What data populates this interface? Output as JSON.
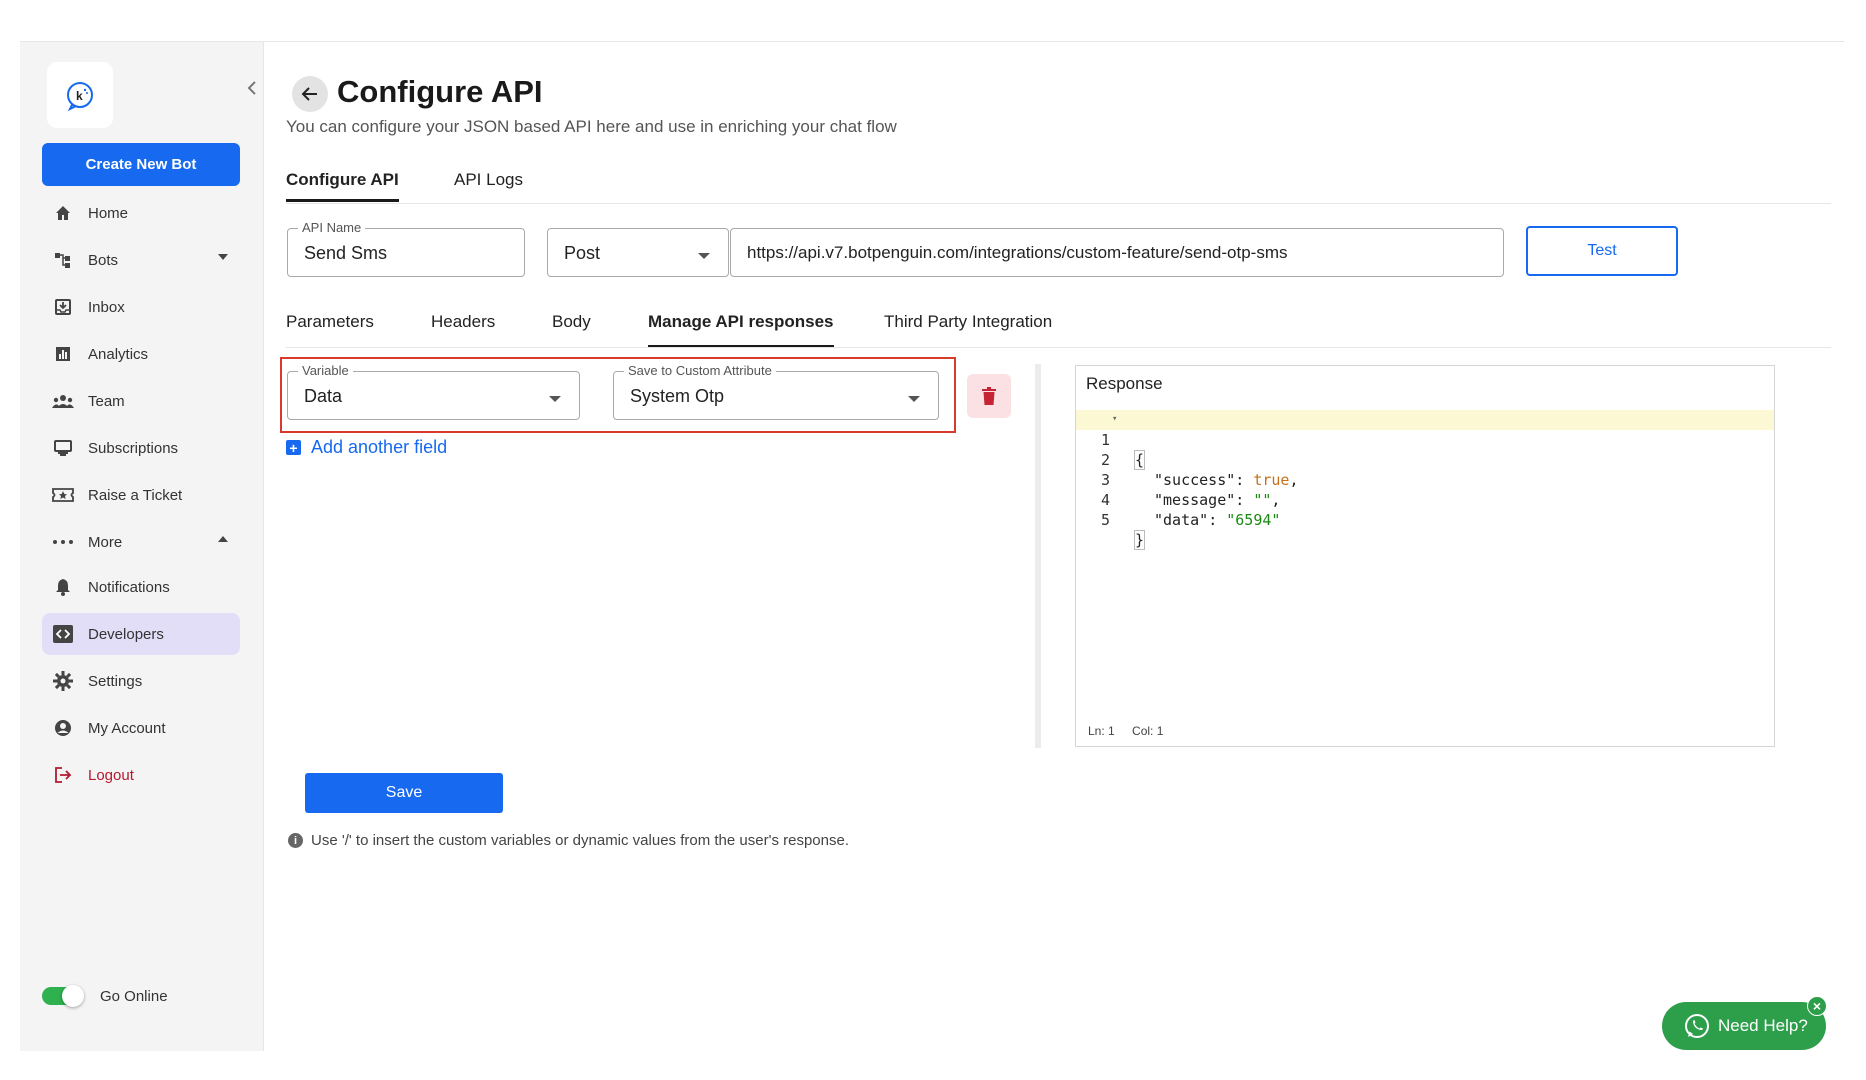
{
  "sidebar": {
    "create_label": "Create New Bot",
    "items": [
      {
        "label": "Home",
        "icon": "home-icon"
      },
      {
        "label": "Bots",
        "icon": "bots-icon"
      },
      {
        "label": "Inbox",
        "icon": "inbox-icon"
      },
      {
        "label": "Analytics",
        "icon": "analytics-icon"
      },
      {
        "label": "Team",
        "icon": "team-icon"
      },
      {
        "label": "Subscriptions",
        "icon": "subscriptions-icon"
      },
      {
        "label": "Raise a Ticket",
        "icon": "ticket-icon"
      },
      {
        "label": "More",
        "icon": "more-icon"
      },
      {
        "label": "Notifications",
        "icon": "bell-icon"
      },
      {
        "label": "Developers",
        "icon": "code-icon"
      },
      {
        "label": "Settings",
        "icon": "gear-icon"
      },
      {
        "label": "My Account",
        "icon": "account-icon"
      },
      {
        "label": "Logout",
        "icon": "logout-icon"
      }
    ],
    "go_online_label": "Go Online",
    "active_item": "Developers"
  },
  "header": {
    "title": "Configure API",
    "subtitle": "You can configure your JSON based API here and use in enriching your chat flow"
  },
  "top_tabs": [
    "Configure API",
    "API Logs"
  ],
  "api_form": {
    "name_label": "API Name",
    "name_value": "Send Sms",
    "method_value": "Post",
    "url_value": "https://api.v7.botpenguin.com/integrations/custom-feature/send-otp-sms",
    "test_label": "Test"
  },
  "sub_tabs": [
    "Parameters",
    "Headers",
    "Body",
    "Manage API responses",
    "Third Party Integration"
  ],
  "mapping": {
    "variable_label": "Variable",
    "variable_value": "Data",
    "attribute_label": "Save to Custom Attribute",
    "attribute_value": "System Otp",
    "add_field_label": "Add another field"
  },
  "response": {
    "title": "Response",
    "line_numbers": [
      "1",
      "2",
      "3",
      "4",
      "5"
    ],
    "ln_label": "Ln: 1",
    "col_label": "Col: 1",
    "code": {
      "open": "{",
      "success_key": "\"success\"",
      "success_val": "true",
      "message_key": "\"message\"",
      "message_val": "\"\"",
      "data_key": "\"data\"",
      "data_val": "\"6594\"",
      "close": "}"
    }
  },
  "save_label": "Save",
  "hint_text": "Use '/' to insert the custom variables or dynamic values from the user's response.",
  "need_help_label": "Need Help?",
  "colors": {
    "primary": "#1769ef",
    "highlight_border": "#d83a2e",
    "whatsapp_green": "#2d9f4b",
    "active_nav": "#e3def7"
  }
}
